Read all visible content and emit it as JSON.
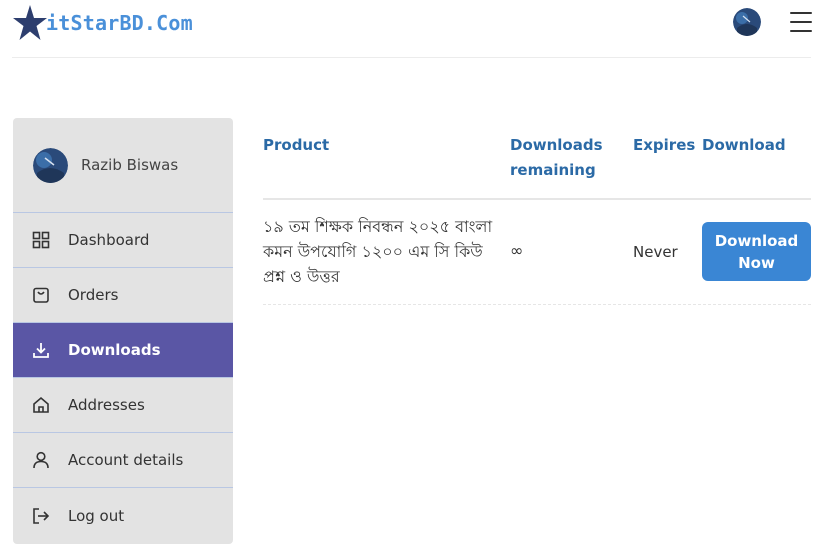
{
  "header": {
    "logo_text": "itStarBD.Com",
    "logo_icon": "star-logo",
    "menu_icon": "hamburger-menu-icon"
  },
  "sidebar": {
    "user_name": "Razib Biswas",
    "items": [
      {
        "label": "Dashboard",
        "icon": "dashboard-grid-icon",
        "active": false
      },
      {
        "label": "Orders",
        "icon": "shopping-bag-icon",
        "active": false
      },
      {
        "label": "Downloads",
        "icon": "download-icon",
        "active": true
      },
      {
        "label": "Addresses",
        "icon": "home-icon",
        "active": false
      },
      {
        "label": "Account details",
        "icon": "user-icon",
        "active": false
      },
      {
        "label": "Log out",
        "icon": "logout-icon",
        "active": false
      }
    ]
  },
  "downloads_table": {
    "headers": {
      "product": "Product",
      "downloads_remaining_1": "Downloads",
      "downloads_remaining_2": "remaining",
      "expires": "Expires",
      "download": "Download"
    },
    "rows": [
      {
        "product_line1": "১৯ তম শিক্ষক নিবন্ধন ২০২৫ বাংলা",
        "product_line2": "কমন উপযোগি ১২০০ এম সি কিউ",
        "product_line3": "প্রশ্ন ও উত্তর",
        "downloads_remaining": "∞",
        "expires": "Never",
        "button_line1": "Download",
        "button_line2": "Now"
      }
    ]
  },
  "colors": {
    "accent": "#5a56a5",
    "link": "#2b6aa6",
    "button": "#3a86d4",
    "sidebar_bg": "#e3e3e3"
  }
}
